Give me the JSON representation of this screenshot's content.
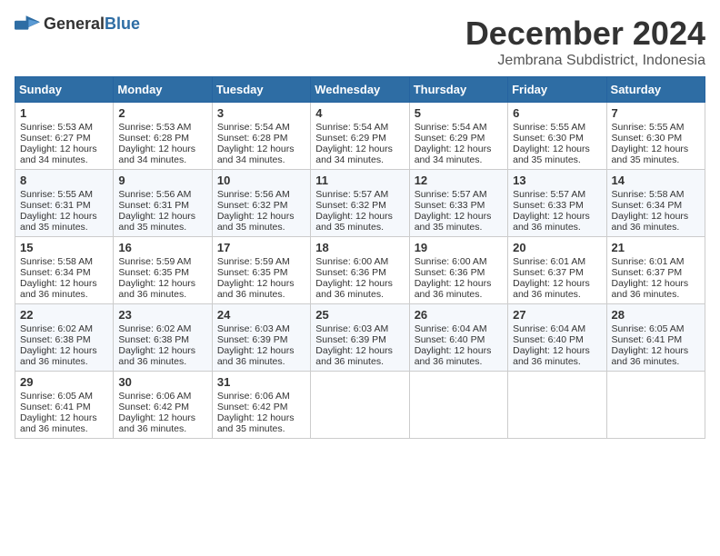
{
  "header": {
    "logo_general": "General",
    "logo_blue": "Blue",
    "month_title": "December 2024",
    "location": "Jembrana Subdistrict, Indonesia"
  },
  "days_of_week": [
    "Sunday",
    "Monday",
    "Tuesday",
    "Wednesday",
    "Thursday",
    "Friday",
    "Saturday"
  ],
  "weeks": [
    [
      {
        "day": "1",
        "sunrise": "5:53 AM",
        "sunset": "6:27 PM",
        "daylight": "12 hours and 34 minutes."
      },
      {
        "day": "2",
        "sunrise": "5:53 AM",
        "sunset": "6:28 PM",
        "daylight": "12 hours and 34 minutes."
      },
      {
        "day": "3",
        "sunrise": "5:54 AM",
        "sunset": "6:28 PM",
        "daylight": "12 hours and 34 minutes."
      },
      {
        "day": "4",
        "sunrise": "5:54 AM",
        "sunset": "6:29 PM",
        "daylight": "12 hours and 34 minutes."
      },
      {
        "day": "5",
        "sunrise": "5:54 AM",
        "sunset": "6:29 PM",
        "daylight": "12 hours and 34 minutes."
      },
      {
        "day": "6",
        "sunrise": "5:55 AM",
        "sunset": "6:30 PM",
        "daylight": "12 hours and 35 minutes."
      },
      {
        "day": "7",
        "sunrise": "5:55 AM",
        "sunset": "6:30 PM",
        "daylight": "12 hours and 35 minutes."
      }
    ],
    [
      {
        "day": "8",
        "sunrise": "5:55 AM",
        "sunset": "6:31 PM",
        "daylight": "12 hours and 35 minutes."
      },
      {
        "day": "9",
        "sunrise": "5:56 AM",
        "sunset": "6:31 PM",
        "daylight": "12 hours and 35 minutes."
      },
      {
        "day": "10",
        "sunrise": "5:56 AM",
        "sunset": "6:32 PM",
        "daylight": "12 hours and 35 minutes."
      },
      {
        "day": "11",
        "sunrise": "5:57 AM",
        "sunset": "6:32 PM",
        "daylight": "12 hours and 35 minutes."
      },
      {
        "day": "12",
        "sunrise": "5:57 AM",
        "sunset": "6:33 PM",
        "daylight": "12 hours and 35 minutes."
      },
      {
        "day": "13",
        "sunrise": "5:57 AM",
        "sunset": "6:33 PM",
        "daylight": "12 hours and 36 minutes."
      },
      {
        "day": "14",
        "sunrise": "5:58 AM",
        "sunset": "6:34 PM",
        "daylight": "12 hours and 36 minutes."
      }
    ],
    [
      {
        "day": "15",
        "sunrise": "5:58 AM",
        "sunset": "6:34 PM",
        "daylight": "12 hours and 36 minutes."
      },
      {
        "day": "16",
        "sunrise": "5:59 AM",
        "sunset": "6:35 PM",
        "daylight": "12 hours and 36 minutes."
      },
      {
        "day": "17",
        "sunrise": "5:59 AM",
        "sunset": "6:35 PM",
        "daylight": "12 hours and 36 minutes."
      },
      {
        "day": "18",
        "sunrise": "6:00 AM",
        "sunset": "6:36 PM",
        "daylight": "12 hours and 36 minutes."
      },
      {
        "day": "19",
        "sunrise": "6:00 AM",
        "sunset": "6:36 PM",
        "daylight": "12 hours and 36 minutes."
      },
      {
        "day": "20",
        "sunrise": "6:01 AM",
        "sunset": "6:37 PM",
        "daylight": "12 hours and 36 minutes."
      },
      {
        "day": "21",
        "sunrise": "6:01 AM",
        "sunset": "6:37 PM",
        "daylight": "12 hours and 36 minutes."
      }
    ],
    [
      {
        "day": "22",
        "sunrise": "6:02 AM",
        "sunset": "6:38 PM",
        "daylight": "12 hours and 36 minutes."
      },
      {
        "day": "23",
        "sunrise": "6:02 AM",
        "sunset": "6:38 PM",
        "daylight": "12 hours and 36 minutes."
      },
      {
        "day": "24",
        "sunrise": "6:03 AM",
        "sunset": "6:39 PM",
        "daylight": "12 hours and 36 minutes."
      },
      {
        "day": "25",
        "sunrise": "6:03 AM",
        "sunset": "6:39 PM",
        "daylight": "12 hours and 36 minutes."
      },
      {
        "day": "26",
        "sunrise": "6:04 AM",
        "sunset": "6:40 PM",
        "daylight": "12 hours and 36 minutes."
      },
      {
        "day": "27",
        "sunrise": "6:04 AM",
        "sunset": "6:40 PM",
        "daylight": "12 hours and 36 minutes."
      },
      {
        "day": "28",
        "sunrise": "6:05 AM",
        "sunset": "6:41 PM",
        "daylight": "12 hours and 36 minutes."
      }
    ],
    [
      {
        "day": "29",
        "sunrise": "6:05 AM",
        "sunset": "6:41 PM",
        "daylight": "12 hours and 36 minutes."
      },
      {
        "day": "30",
        "sunrise": "6:06 AM",
        "sunset": "6:42 PM",
        "daylight": "12 hours and 36 minutes."
      },
      {
        "day": "31",
        "sunrise": "6:06 AM",
        "sunset": "6:42 PM",
        "daylight": "12 hours and 35 minutes."
      },
      null,
      null,
      null,
      null
    ]
  ],
  "labels": {
    "sunrise": "Sunrise:",
    "sunset": "Sunset:",
    "daylight": "Daylight:"
  }
}
